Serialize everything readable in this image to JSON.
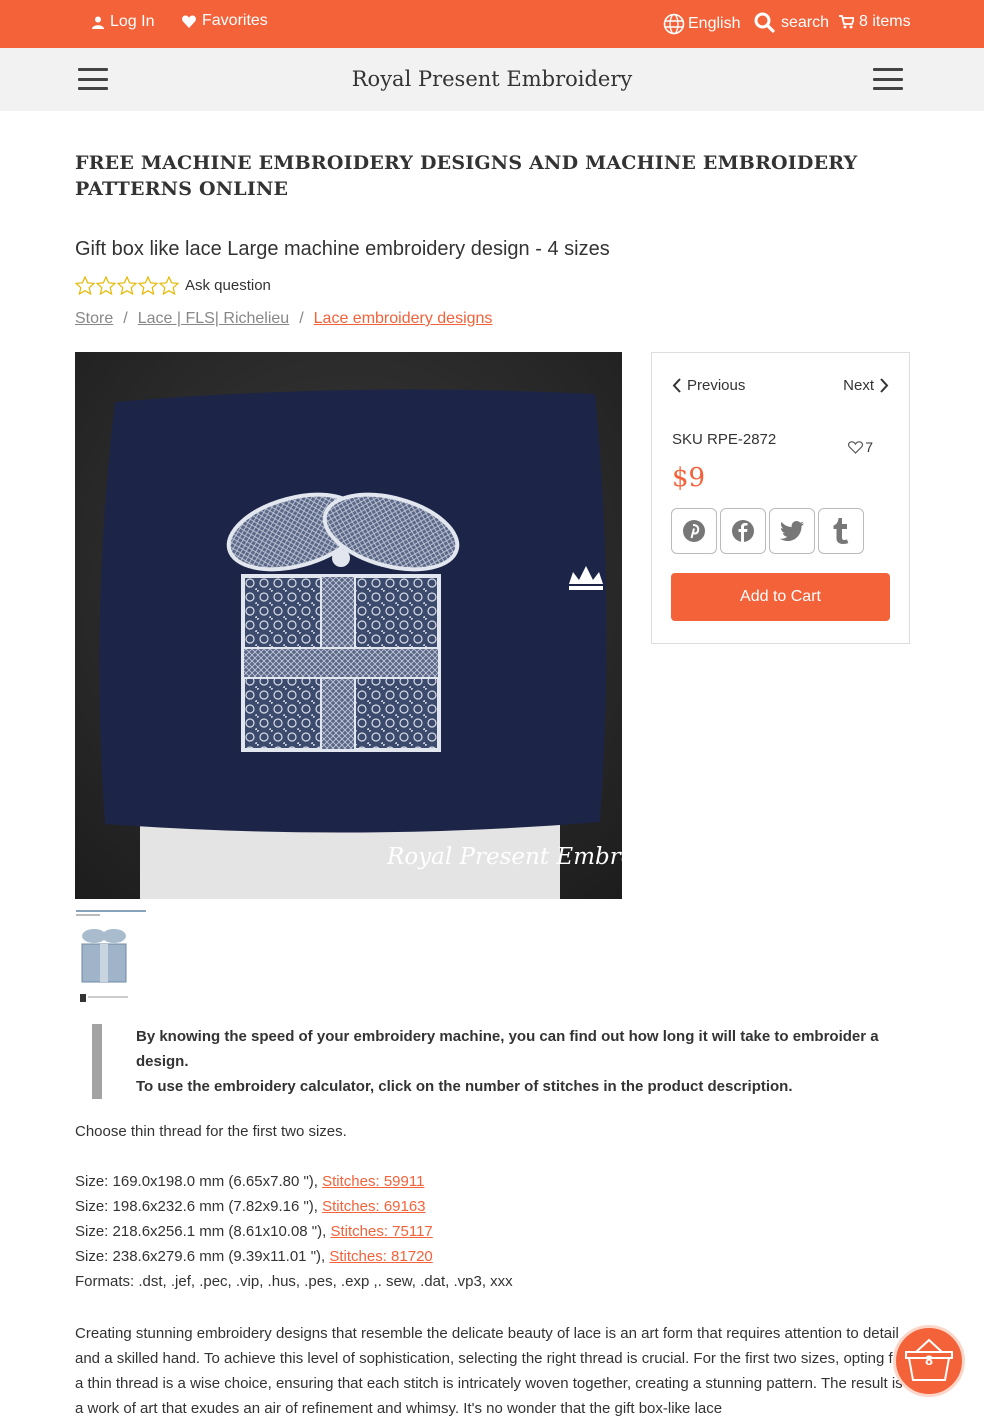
{
  "topbar": {
    "login": "Log In",
    "favorites": "Favorites",
    "language": "English",
    "search": "search",
    "cart": "8 items"
  },
  "navbar": {
    "title": "Royal Present Embroidery"
  },
  "page_heading": "FREE MACHINE EMBROIDERY DESIGNS AND MACHINE EMBROIDERY PATTERNS ONLINE",
  "product": {
    "title": "Gift box like lace Large machine embroidery design - 4 sizes",
    "rating_stars": 0,
    "ask_question": "Ask question",
    "watermark": "Royal Present Embroidery"
  },
  "breadcrumb": [
    {
      "label": "Store"
    },
    {
      "label": "Lace | FLS| Richelieu"
    },
    {
      "label": "Lace embroidery designs"
    }
  ],
  "sidebox": {
    "previous": "Previous",
    "next": "Next",
    "sku": "SKU RPE-2872",
    "favorites_count": "7",
    "price": "$9",
    "add_to_cart": "Add to Cart"
  },
  "note": {
    "line1": "By knowing the speed of your embroidery machine, you can find out how long it will take to embroider a design.",
    "line2": "To use the embroidery calculator, click on the number of stitches in the product description."
  },
  "description": {
    "intro": "Choose thin thread for the first two sizes.",
    "sizes": [
      {
        "text": "Size: 169.0x198.0 mm (6.65x7.80 \"), ",
        "stitches": "Stitches: 59911"
      },
      {
        "text": "Size: 198.6x232.6 mm (7.82x9.16 \"), ",
        "stitches": "Stitches: 69163"
      },
      {
        "text": "Size: 218.6x256.1 mm (8.61x10.08 \"), ",
        "stitches": "Stitches: 75117"
      },
      {
        "text": "Size: 238.6x279.6 mm (9.39x11.01 \"), ",
        "stitches": "Stitches: 81720"
      }
    ],
    "formats": "Formats: .dst, .jef, .pec, .vip, .hus, .pes, .exp ,. sew, .dat, .vp3, xxx",
    "paragraph": "Creating stunning embroidery designs that resemble the delicate beauty of lace is an art form that requires attention to detail and a skilled hand. To achieve this level of sophistication, selecting the right thread is crucial. For the first two sizes, opting for a thin thread is a wise choice, ensuring that each stitch is intricately woven together, creating a stunning pattern. The result is a work of art that exudes an air of refinement and whimsy. It's no wonder that the gift box-like lace"
  },
  "floating_cart": {
    "count": "8"
  },
  "colors": {
    "accent": "#f4623a",
    "navbar_bg": "#f2f2f2",
    "pillow": "#1c2547"
  }
}
